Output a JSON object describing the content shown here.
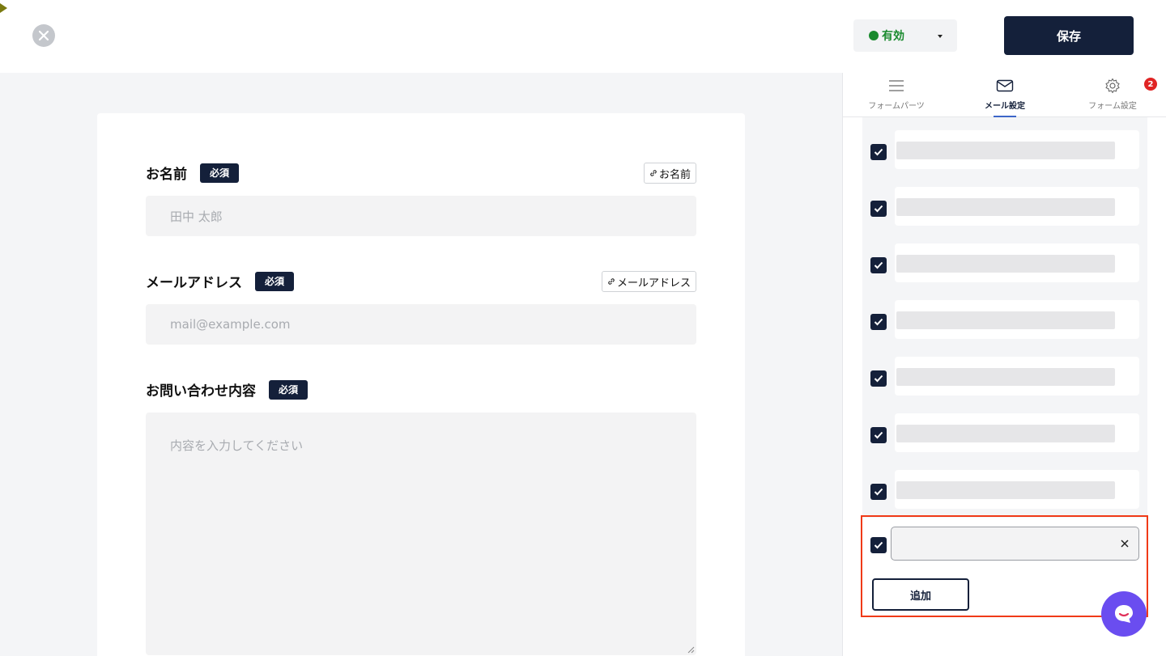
{
  "header": {
    "status": {
      "label": "有効",
      "color": "#1a8a2e"
    },
    "save_label": "保存"
  },
  "form": {
    "fields": [
      {
        "label": "お名前",
        "required_label": "必須",
        "link_label": "お名前",
        "placeholder": "田中 太郎"
      },
      {
        "label": "メールアドレス",
        "required_label": "必須",
        "link_label": "メールアドレス",
        "placeholder": "mail@example.com"
      },
      {
        "label": "お問い合わせ内容",
        "required_label": "必須",
        "placeholder": "内容を入力してください"
      }
    ]
  },
  "panel": {
    "tabs": [
      {
        "label": "フォームパーツ",
        "icon": "menu-icon"
      },
      {
        "label": "メール設定",
        "icon": "mail-icon",
        "active": true
      },
      {
        "label": "フォーム設定",
        "icon": "gear-icon",
        "badge": "2"
      }
    ],
    "add_label": "追加"
  },
  "colors": {
    "primary": "#14203a",
    "accent": "#3d66c8",
    "highlight": "#f03a17",
    "chat": "#6a4df0"
  }
}
